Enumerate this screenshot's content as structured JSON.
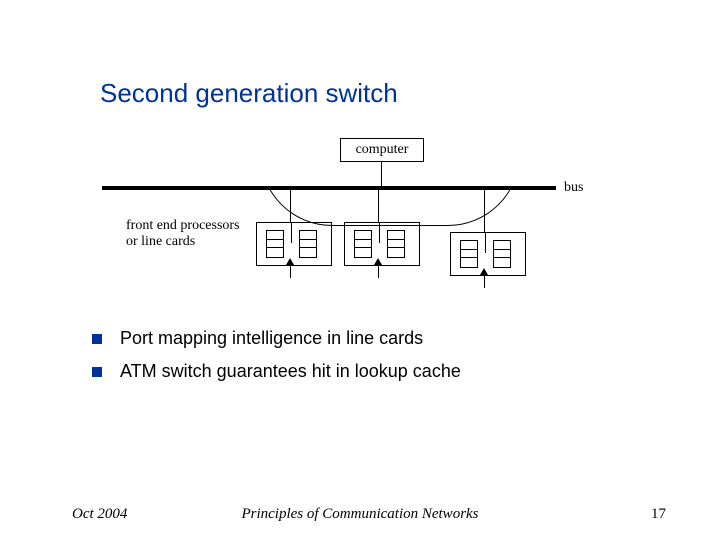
{
  "title": "Second generation switch",
  "diagram": {
    "computer_label": "computer",
    "bus_label": "bus",
    "fep_label": "front end processors\nor line cards"
  },
  "bullets": [
    "Port mapping intelligence in line cards",
    "ATM switch guarantees hit in lookup cache"
  ],
  "footer": {
    "left": "Oct 2004",
    "center": "Principles of Communication Networks",
    "right": "17"
  }
}
